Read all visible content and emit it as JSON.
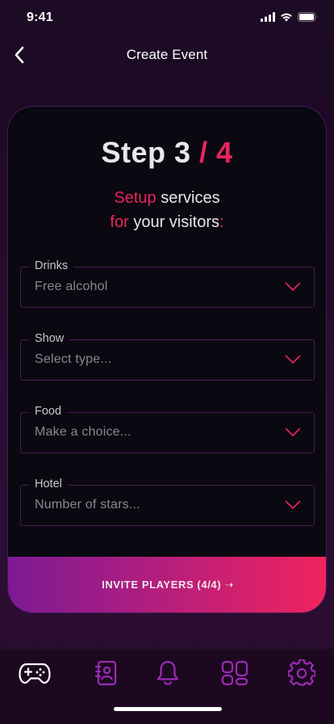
{
  "status_bar": {
    "time": "9:41"
  },
  "header": {
    "title": "Create Event"
  },
  "step": {
    "word": "Step 3",
    "slash": " / ",
    "total": "4"
  },
  "subtitle": {
    "line1_accent": "Setup",
    "line1_rest": " services",
    "line2_accent": "for",
    "line2_rest": " your visitors",
    "line2_end": ":"
  },
  "fields": [
    {
      "label": "Drinks",
      "value": "Free alcohol"
    },
    {
      "label": "Show",
      "value": "Select type..."
    },
    {
      "label": "Food",
      "value": "Make a choice..."
    },
    {
      "label": "Hotel",
      "value": "Number of stars..."
    }
  ],
  "invite_button": {
    "label": "INVITE PLAYERS (4/4) ➝"
  },
  "nav": {
    "items": [
      "gamepad-icon",
      "contacts-icon",
      "bell-icon",
      "dashboard-icon",
      "gear-icon"
    ],
    "active": "gamepad-icon"
  },
  "colors": {
    "accent": "#e8265e",
    "purple": "#9b2bb5",
    "card_bg": "#0a0810"
  }
}
